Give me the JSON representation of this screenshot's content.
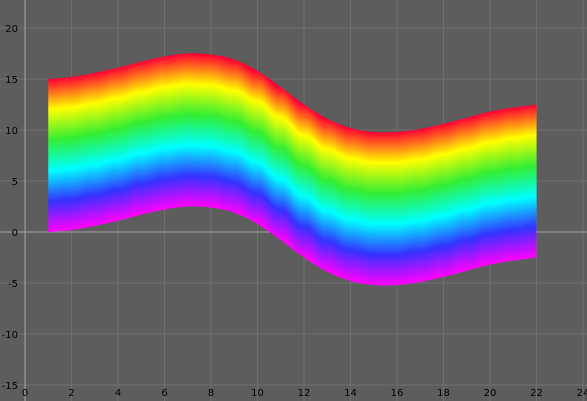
{
  "chart_data": {
    "type": "area",
    "x": [
      1,
      2,
      3,
      4,
      5,
      6,
      7,
      8,
      9,
      10,
      11,
      12,
      13,
      14,
      15,
      16,
      17,
      18,
      19,
      20,
      21,
      22
    ],
    "top": [
      15,
      15.2,
      15.6,
      16.1,
      16.7,
      17.2,
      17.5,
      17.4,
      16.9,
      15.8,
      14.2,
      12.5,
      11.1,
      10.2,
      9.8,
      9.8,
      10.1,
      10.6,
      11.2,
      11.8,
      12.2,
      12.5
    ],
    "bottom": [
      0,
      0.2,
      0.6,
      1.1,
      1.7,
      2.2,
      2.5,
      2.4,
      1.9,
      0.8,
      -0.8,
      -2.5,
      -3.9,
      -4.8,
      -5.2,
      -5.2,
      -4.9,
      -4.4,
      -3.8,
      -3.2,
      -2.8,
      -2.5
    ],
    "color_gradient": [
      "#ff0033",
      "#ffff00",
      "#33ee33",
      "#00ffff",
      "#3333ff",
      "#ff00ff"
    ],
    "xlim": [
      0,
      24
    ],
    "ylim": [
      -15,
      22
    ],
    "x_ticks": [
      "0",
      "2",
      "4",
      "6",
      "8",
      "10",
      "12",
      "14",
      "16",
      "18",
      "20",
      "22",
      "24"
    ],
    "y_ticks": [
      "-15",
      "-10",
      "-5",
      "0",
      "5",
      "10",
      "15",
      "20"
    ],
    "grid": true,
    "background": "#5d5d5d",
    "grid_color": "#6e6e6e",
    "axis_color": "#a8a8a8",
    "title": "",
    "xlabel": "",
    "ylabel": ""
  }
}
